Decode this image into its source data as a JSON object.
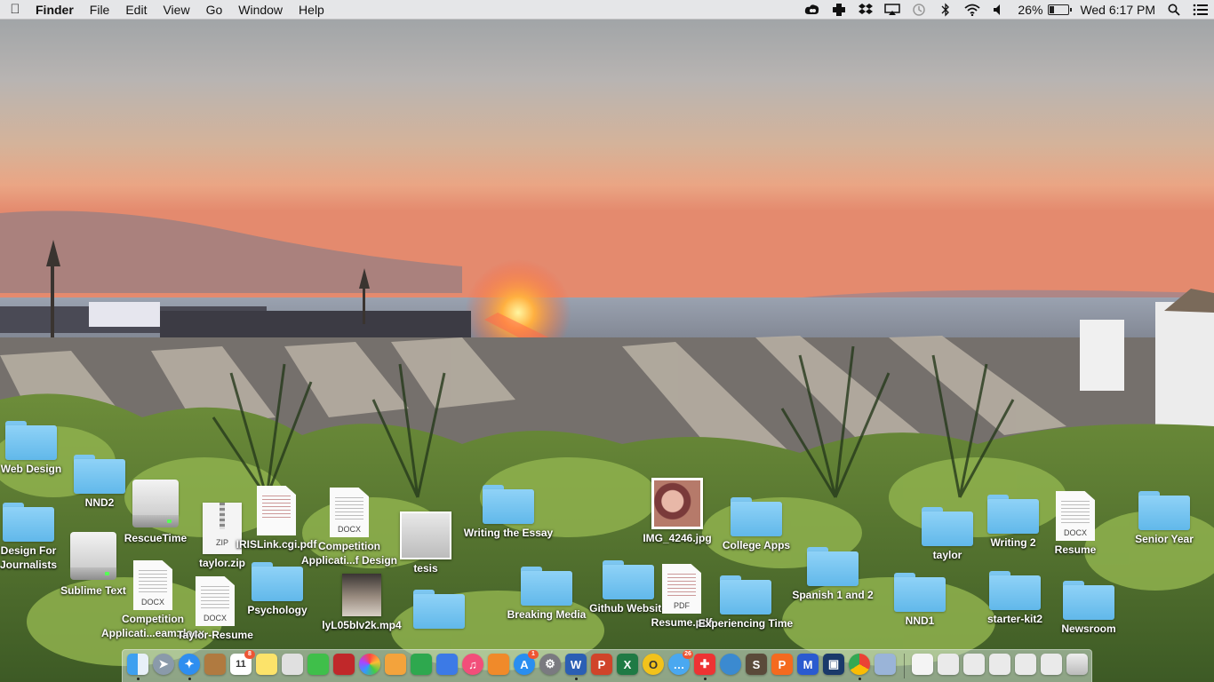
{
  "menubar": {
    "app_name": "Finder",
    "menus": [
      "File",
      "Edit",
      "View",
      "Go",
      "Window",
      "Help"
    ],
    "battery_percent": "26%",
    "battery_level": 0.26,
    "clock": "Wed 6:17 PM"
  },
  "desktop_icons": {
    "web_design": "Web Design",
    "nnd2": "NND2",
    "design_for_journalists": "Design For Journalists",
    "rescuetime": "RescueTime",
    "sublime_text": "Sublime Text",
    "taylor_zip": "taylor.zip",
    "irislink_pdf": "IRISLink.cgi.pdf",
    "competition_app_design": "Competition Applicati...f Design",
    "competition_app_eam": "Competition Applicati...eam.docx",
    "taylor_resume": "Taylor-Resume",
    "psychology": "Psychology",
    "video_mp4": "lyL05bIv2k.mp4",
    "tesis": "tesis",
    "writing_the_essay": "Writing the Essay",
    "breaking_media": "Breaking Media",
    "github_website": "Github Website",
    "img_4246": "IMG_4246.jpg",
    "resume_pdf": "Resume.pdf",
    "college_apps": "College Apps",
    "experiencing_time": "Experiencing Time",
    "spanish": "Spanish 1 and 2",
    "taylor": "taylor",
    "nnd1": "NND1",
    "writing_2": "Writing 2",
    "starter_kit2": "starter-kit2",
    "resume": "Resume",
    "newsroom": "Newsroom",
    "senior_year": "Senior Year"
  },
  "file_tags": {
    "docx": "DOCX",
    "pdf": "PDF",
    "zip": "ZIP"
  },
  "dock": {
    "calendar_day": "11",
    "calendar_month": "JAN",
    "appstore_badge": "1",
    "messages_badge": "26",
    "calendar_badge": "8"
  }
}
